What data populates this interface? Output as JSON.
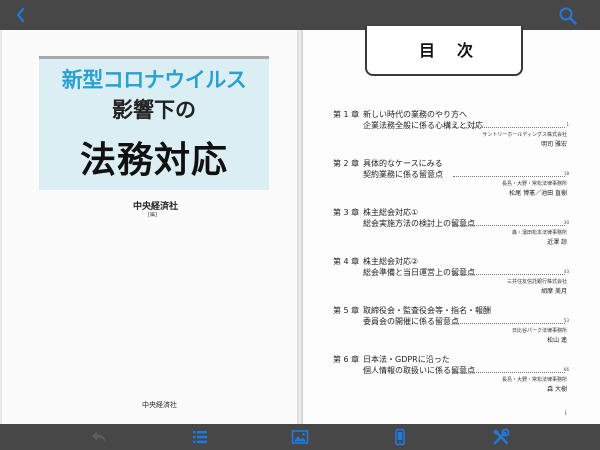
{
  "colors": {
    "toolbar_bg": "#474747",
    "accent": "#1f7ae0",
    "disabled_icon": "#5d5d5d",
    "cover_band": "#dbeef4",
    "cover_title_blue": "#2aa2d0"
  },
  "toolbar_top": {
    "back_icon": "chevron-left-icon",
    "search_icon": "search-icon"
  },
  "cover": {
    "title_line1": "新型コロナウイルス",
    "title_line2": "影響下の",
    "title_line3": "法務対応",
    "publisher_top": "中央経済社",
    "editor_mark": "[編]",
    "publisher_bottom": "中央経済社"
  },
  "toc": {
    "heading": "目次",
    "page_number": "i",
    "entries": [
      {
        "chapter": "第 1 章",
        "line1": "新しい時代の業務のやり方へ",
        "line2": "企業法務全般に係る心構えと対応",
        "page": "1",
        "author_org": "サントリーホールディングス株式会社",
        "author_name": "明司 雅宏"
      },
      {
        "chapter": "第 2 章",
        "line1": "具体的なケースにみる",
        "line2": "契約業務に係る留意点",
        "page": "18",
        "author_org": "長島・大野・常松法律事務所",
        "author_name": "松尾 博憲／池田 直樹"
      },
      {
        "chapter": "第 3 章",
        "line1": "株主総会対応①",
        "line2": "総会実施方法の検討上の留意点",
        "page": "30",
        "author_org": "森・濱田松本法律事務所",
        "author_name": "近澤 諒"
      },
      {
        "chapter": "第 4 章",
        "line1": "株主総会対応②",
        "line2": "総会準備と当日運営上の留意点",
        "page": "43",
        "author_org": "三井住友信託銀行株式会社",
        "author_name": "胡摩 美月"
      },
      {
        "chapter": "第 5 章",
        "line1": "取締役会・監査役会等・指名・報酬",
        "line2": "委員会の開催に係る留意点",
        "page": "53",
        "author_org": "日比谷パーク法律事務所",
        "author_name": "松山 遙"
      },
      {
        "chapter": "第 6 章",
        "line1": "日本法・GDPRに沿った",
        "line2": "個人情報の取扱いに係る留意点",
        "page": "66",
        "author_org": "長島・大野・常松法律事務所",
        "author_name": "森 大樹"
      }
    ]
  },
  "toolbar_bottom": {
    "items": [
      {
        "icon": "undo-arrow-icon",
        "enabled": false
      },
      {
        "icon": "list-icon",
        "enabled": true
      },
      {
        "icon": "image-icon",
        "enabled": true
      },
      {
        "icon": "device-icon",
        "enabled": true
      },
      {
        "icon": "tools-icon",
        "enabled": true
      }
    ]
  }
}
